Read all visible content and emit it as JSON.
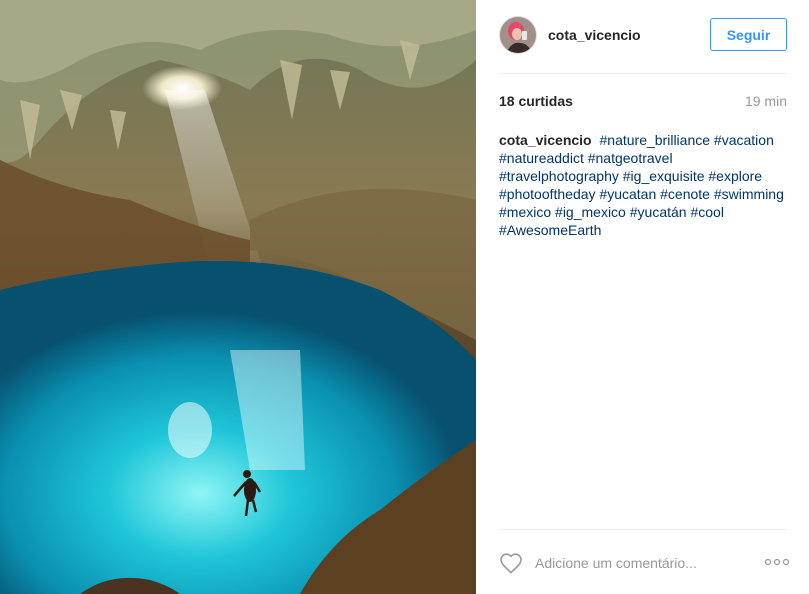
{
  "post": {
    "photo_icon": "cenote-photo",
    "author": {
      "username": "cota_vicencio",
      "avatar_icon": "profile-photo"
    },
    "follow_label": "Seguir",
    "likes": "18 curtidas",
    "time_ago": "19 min",
    "caption": {
      "username": "cota_vicencio",
      "hashtags": [
        "#nature_brilliance",
        "#vacation",
        "#natureaddict",
        "#natgeotravel",
        "#travelphotography",
        "#ig_exquisite",
        "#explore",
        "#photooftheday",
        "#yucatan",
        "#cenote",
        "#swimming",
        "#mexico",
        "#ig_mexico",
        "#yucatán",
        "#cool",
        "#AwesomeEarth"
      ]
    },
    "comment_placeholder": "Adicione um comentário...",
    "colors": {
      "accent": "#3897f0",
      "hashtag": "#003569",
      "text": "#262626",
      "muted": "#999999"
    }
  }
}
